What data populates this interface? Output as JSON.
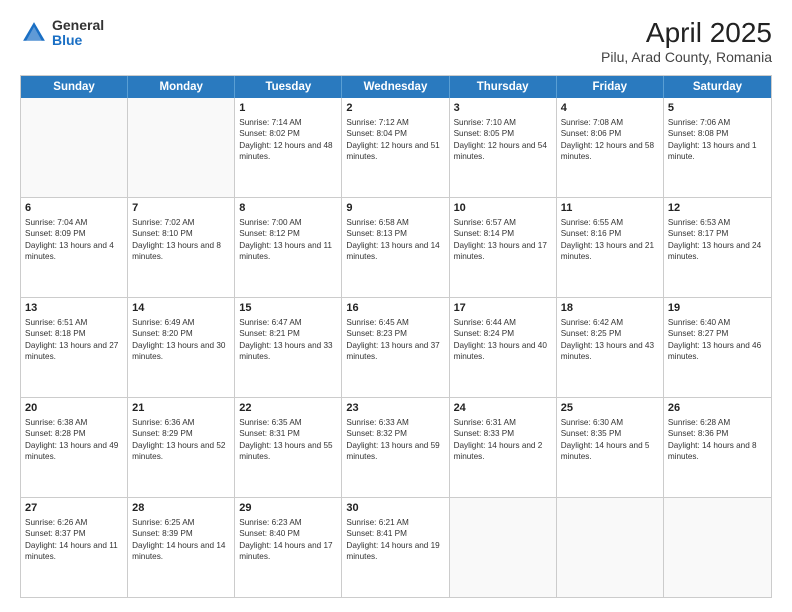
{
  "header": {
    "logo_general": "General",
    "logo_blue": "Blue",
    "title": "April 2025",
    "subtitle": "Pilu, Arad County, Romania"
  },
  "calendar": {
    "days_of_week": [
      "Sunday",
      "Monday",
      "Tuesday",
      "Wednesday",
      "Thursday",
      "Friday",
      "Saturday"
    ],
    "weeks": [
      [
        {
          "day": "",
          "info": ""
        },
        {
          "day": "",
          "info": ""
        },
        {
          "day": "1",
          "info": "Sunrise: 7:14 AM\nSunset: 8:02 PM\nDaylight: 12 hours and 48 minutes."
        },
        {
          "day": "2",
          "info": "Sunrise: 7:12 AM\nSunset: 8:04 PM\nDaylight: 12 hours and 51 minutes."
        },
        {
          "day": "3",
          "info": "Sunrise: 7:10 AM\nSunset: 8:05 PM\nDaylight: 12 hours and 54 minutes."
        },
        {
          "day": "4",
          "info": "Sunrise: 7:08 AM\nSunset: 8:06 PM\nDaylight: 12 hours and 58 minutes."
        },
        {
          "day": "5",
          "info": "Sunrise: 7:06 AM\nSunset: 8:08 PM\nDaylight: 13 hours and 1 minute."
        }
      ],
      [
        {
          "day": "6",
          "info": "Sunrise: 7:04 AM\nSunset: 8:09 PM\nDaylight: 13 hours and 4 minutes."
        },
        {
          "day": "7",
          "info": "Sunrise: 7:02 AM\nSunset: 8:10 PM\nDaylight: 13 hours and 8 minutes."
        },
        {
          "day": "8",
          "info": "Sunrise: 7:00 AM\nSunset: 8:12 PM\nDaylight: 13 hours and 11 minutes."
        },
        {
          "day": "9",
          "info": "Sunrise: 6:58 AM\nSunset: 8:13 PM\nDaylight: 13 hours and 14 minutes."
        },
        {
          "day": "10",
          "info": "Sunrise: 6:57 AM\nSunset: 8:14 PM\nDaylight: 13 hours and 17 minutes."
        },
        {
          "day": "11",
          "info": "Sunrise: 6:55 AM\nSunset: 8:16 PM\nDaylight: 13 hours and 21 minutes."
        },
        {
          "day": "12",
          "info": "Sunrise: 6:53 AM\nSunset: 8:17 PM\nDaylight: 13 hours and 24 minutes."
        }
      ],
      [
        {
          "day": "13",
          "info": "Sunrise: 6:51 AM\nSunset: 8:18 PM\nDaylight: 13 hours and 27 minutes."
        },
        {
          "day": "14",
          "info": "Sunrise: 6:49 AM\nSunset: 8:20 PM\nDaylight: 13 hours and 30 minutes."
        },
        {
          "day": "15",
          "info": "Sunrise: 6:47 AM\nSunset: 8:21 PM\nDaylight: 13 hours and 33 minutes."
        },
        {
          "day": "16",
          "info": "Sunrise: 6:45 AM\nSunset: 8:23 PM\nDaylight: 13 hours and 37 minutes."
        },
        {
          "day": "17",
          "info": "Sunrise: 6:44 AM\nSunset: 8:24 PM\nDaylight: 13 hours and 40 minutes."
        },
        {
          "day": "18",
          "info": "Sunrise: 6:42 AM\nSunset: 8:25 PM\nDaylight: 13 hours and 43 minutes."
        },
        {
          "day": "19",
          "info": "Sunrise: 6:40 AM\nSunset: 8:27 PM\nDaylight: 13 hours and 46 minutes."
        }
      ],
      [
        {
          "day": "20",
          "info": "Sunrise: 6:38 AM\nSunset: 8:28 PM\nDaylight: 13 hours and 49 minutes."
        },
        {
          "day": "21",
          "info": "Sunrise: 6:36 AM\nSunset: 8:29 PM\nDaylight: 13 hours and 52 minutes."
        },
        {
          "day": "22",
          "info": "Sunrise: 6:35 AM\nSunset: 8:31 PM\nDaylight: 13 hours and 55 minutes."
        },
        {
          "day": "23",
          "info": "Sunrise: 6:33 AM\nSunset: 8:32 PM\nDaylight: 13 hours and 59 minutes."
        },
        {
          "day": "24",
          "info": "Sunrise: 6:31 AM\nSunset: 8:33 PM\nDaylight: 14 hours and 2 minutes."
        },
        {
          "day": "25",
          "info": "Sunrise: 6:30 AM\nSunset: 8:35 PM\nDaylight: 14 hours and 5 minutes."
        },
        {
          "day": "26",
          "info": "Sunrise: 6:28 AM\nSunset: 8:36 PM\nDaylight: 14 hours and 8 minutes."
        }
      ],
      [
        {
          "day": "27",
          "info": "Sunrise: 6:26 AM\nSunset: 8:37 PM\nDaylight: 14 hours and 11 minutes."
        },
        {
          "day": "28",
          "info": "Sunrise: 6:25 AM\nSunset: 8:39 PM\nDaylight: 14 hours and 14 minutes."
        },
        {
          "day": "29",
          "info": "Sunrise: 6:23 AM\nSunset: 8:40 PM\nDaylight: 14 hours and 17 minutes."
        },
        {
          "day": "30",
          "info": "Sunrise: 6:21 AM\nSunset: 8:41 PM\nDaylight: 14 hours and 19 minutes."
        },
        {
          "day": "",
          "info": ""
        },
        {
          "day": "",
          "info": ""
        },
        {
          "day": "",
          "info": ""
        }
      ]
    ]
  }
}
